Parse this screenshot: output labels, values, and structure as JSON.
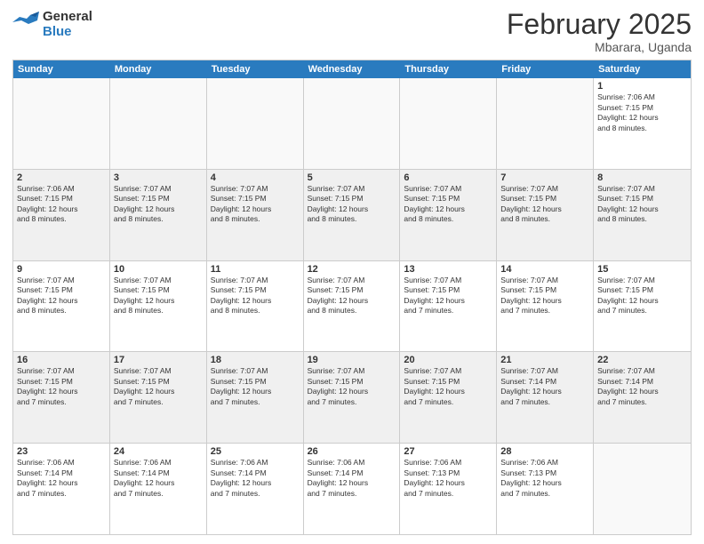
{
  "logo": {
    "line1": "General",
    "line2": "Blue"
  },
  "title": "February 2025",
  "location": "Mbarara, Uganda",
  "header_days": [
    "Sunday",
    "Monday",
    "Tuesday",
    "Wednesday",
    "Thursday",
    "Friday",
    "Saturday"
  ],
  "weeks": [
    [
      {
        "day": "",
        "info": ""
      },
      {
        "day": "",
        "info": ""
      },
      {
        "day": "",
        "info": ""
      },
      {
        "day": "",
        "info": ""
      },
      {
        "day": "",
        "info": ""
      },
      {
        "day": "",
        "info": ""
      },
      {
        "day": "1",
        "info": "Sunrise: 7:06 AM\nSunset: 7:15 PM\nDaylight: 12 hours\nand 8 minutes."
      }
    ],
    [
      {
        "day": "2",
        "info": "Sunrise: 7:06 AM\nSunset: 7:15 PM\nDaylight: 12 hours\nand 8 minutes."
      },
      {
        "day": "3",
        "info": "Sunrise: 7:07 AM\nSunset: 7:15 PM\nDaylight: 12 hours\nand 8 minutes."
      },
      {
        "day": "4",
        "info": "Sunrise: 7:07 AM\nSunset: 7:15 PM\nDaylight: 12 hours\nand 8 minutes."
      },
      {
        "day": "5",
        "info": "Sunrise: 7:07 AM\nSunset: 7:15 PM\nDaylight: 12 hours\nand 8 minutes."
      },
      {
        "day": "6",
        "info": "Sunrise: 7:07 AM\nSunset: 7:15 PM\nDaylight: 12 hours\nand 8 minutes."
      },
      {
        "day": "7",
        "info": "Sunrise: 7:07 AM\nSunset: 7:15 PM\nDaylight: 12 hours\nand 8 minutes."
      },
      {
        "day": "8",
        "info": "Sunrise: 7:07 AM\nSunset: 7:15 PM\nDaylight: 12 hours\nand 8 minutes."
      }
    ],
    [
      {
        "day": "9",
        "info": "Sunrise: 7:07 AM\nSunset: 7:15 PM\nDaylight: 12 hours\nand 8 minutes."
      },
      {
        "day": "10",
        "info": "Sunrise: 7:07 AM\nSunset: 7:15 PM\nDaylight: 12 hours\nand 8 minutes."
      },
      {
        "day": "11",
        "info": "Sunrise: 7:07 AM\nSunset: 7:15 PM\nDaylight: 12 hours\nand 8 minutes."
      },
      {
        "day": "12",
        "info": "Sunrise: 7:07 AM\nSunset: 7:15 PM\nDaylight: 12 hours\nand 8 minutes."
      },
      {
        "day": "13",
        "info": "Sunrise: 7:07 AM\nSunset: 7:15 PM\nDaylight: 12 hours\nand 7 minutes."
      },
      {
        "day": "14",
        "info": "Sunrise: 7:07 AM\nSunset: 7:15 PM\nDaylight: 12 hours\nand 7 minutes."
      },
      {
        "day": "15",
        "info": "Sunrise: 7:07 AM\nSunset: 7:15 PM\nDaylight: 12 hours\nand 7 minutes."
      }
    ],
    [
      {
        "day": "16",
        "info": "Sunrise: 7:07 AM\nSunset: 7:15 PM\nDaylight: 12 hours\nand 7 minutes."
      },
      {
        "day": "17",
        "info": "Sunrise: 7:07 AM\nSunset: 7:15 PM\nDaylight: 12 hours\nand 7 minutes."
      },
      {
        "day": "18",
        "info": "Sunrise: 7:07 AM\nSunset: 7:15 PM\nDaylight: 12 hours\nand 7 minutes."
      },
      {
        "day": "19",
        "info": "Sunrise: 7:07 AM\nSunset: 7:15 PM\nDaylight: 12 hours\nand 7 minutes."
      },
      {
        "day": "20",
        "info": "Sunrise: 7:07 AM\nSunset: 7:15 PM\nDaylight: 12 hours\nand 7 minutes."
      },
      {
        "day": "21",
        "info": "Sunrise: 7:07 AM\nSunset: 7:14 PM\nDaylight: 12 hours\nand 7 minutes."
      },
      {
        "day": "22",
        "info": "Sunrise: 7:07 AM\nSunset: 7:14 PM\nDaylight: 12 hours\nand 7 minutes."
      }
    ],
    [
      {
        "day": "23",
        "info": "Sunrise: 7:06 AM\nSunset: 7:14 PM\nDaylight: 12 hours\nand 7 minutes."
      },
      {
        "day": "24",
        "info": "Sunrise: 7:06 AM\nSunset: 7:14 PM\nDaylight: 12 hours\nand 7 minutes."
      },
      {
        "day": "25",
        "info": "Sunrise: 7:06 AM\nSunset: 7:14 PM\nDaylight: 12 hours\nand 7 minutes."
      },
      {
        "day": "26",
        "info": "Sunrise: 7:06 AM\nSunset: 7:14 PM\nDaylight: 12 hours\nand 7 minutes."
      },
      {
        "day": "27",
        "info": "Sunrise: 7:06 AM\nSunset: 7:13 PM\nDaylight: 12 hours\nand 7 minutes."
      },
      {
        "day": "28",
        "info": "Sunrise: 7:06 AM\nSunset: 7:13 PM\nDaylight: 12 hours\nand 7 minutes."
      },
      {
        "day": "",
        "info": ""
      }
    ]
  ]
}
